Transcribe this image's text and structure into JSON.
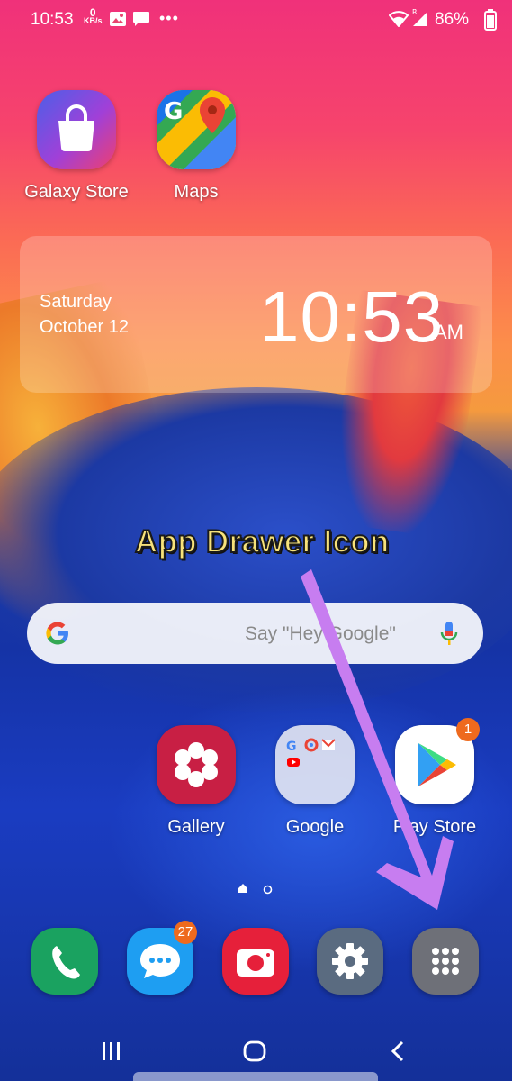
{
  "status_bar": {
    "time": "10:53",
    "net_speed_value": "0",
    "net_speed_unit": "KB/s",
    "battery_percent": "86%"
  },
  "home_apps": [
    {
      "label": "Galaxy Store"
    },
    {
      "label": "Maps"
    }
  ],
  "clock_widget": {
    "day": "Saturday",
    "date": "October 12",
    "time": "10:53",
    "ampm": "AM"
  },
  "annotation": {
    "text": "App Drawer Icon"
  },
  "search_bar": {
    "placeholder": "Say \"Hey Google\""
  },
  "row_apps": [
    {
      "label": "Gallery"
    },
    {
      "label": "Google"
    },
    {
      "label": "Play Store",
      "badge": "1"
    }
  ],
  "dock": {
    "messages_badge": "27"
  },
  "colors": {
    "annotation_text": "#f7e27a",
    "arrow": "#c77df0",
    "badge": "#ee6a1e"
  }
}
